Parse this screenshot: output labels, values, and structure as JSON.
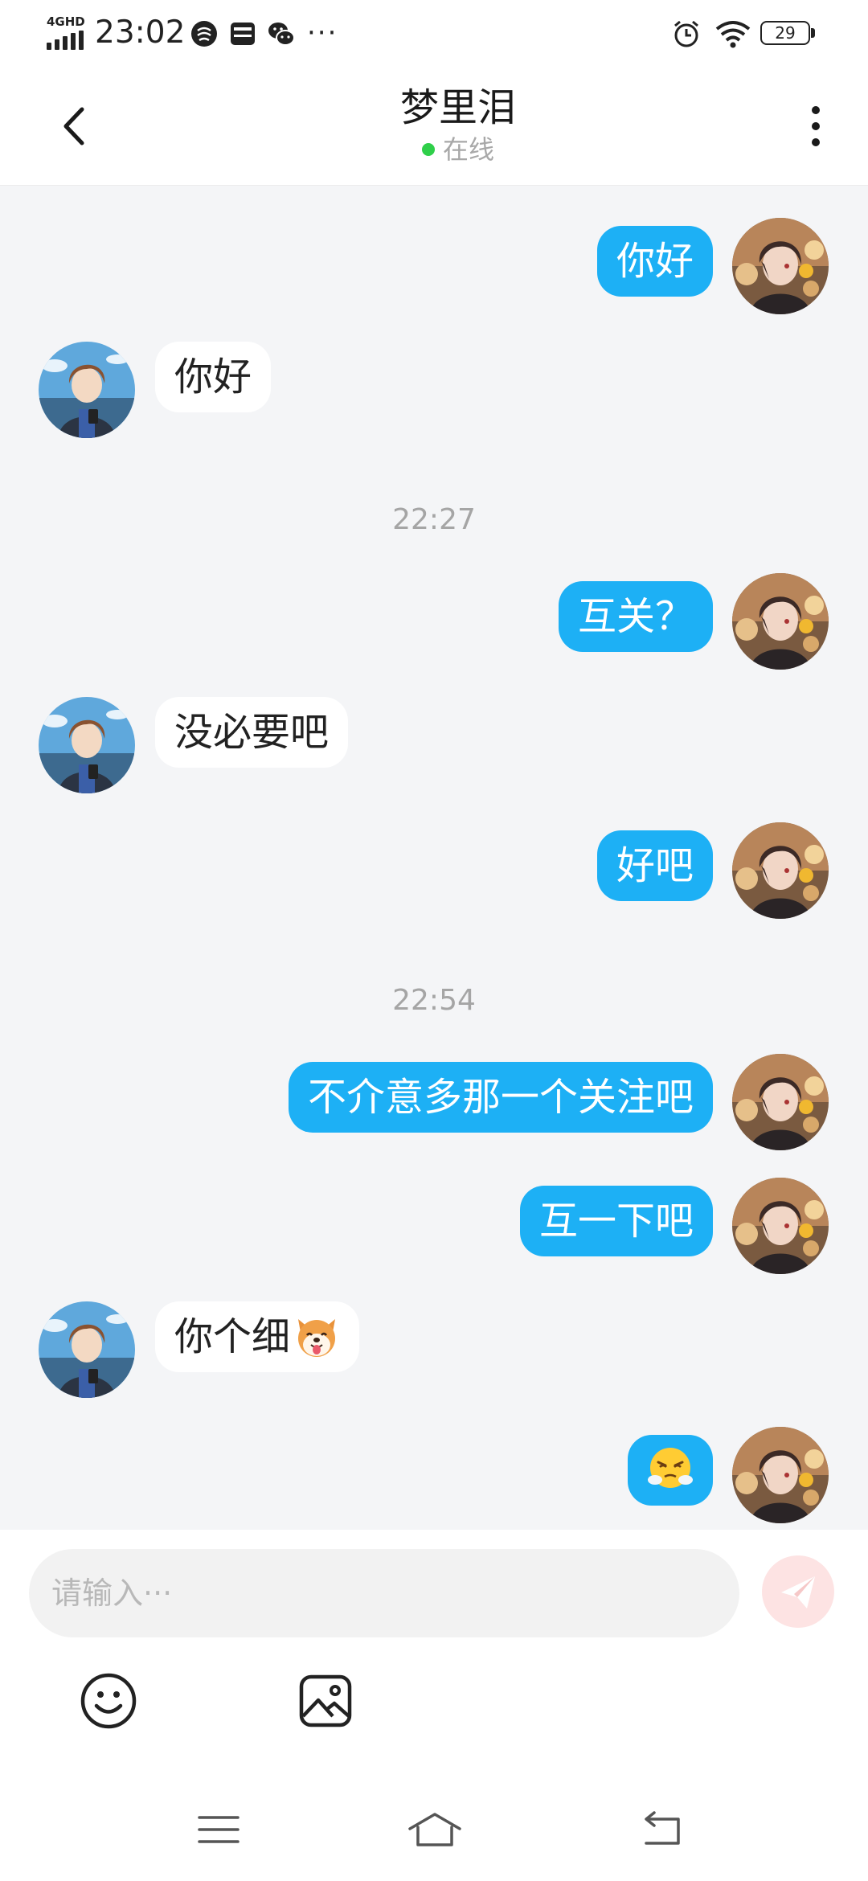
{
  "status_bar": {
    "network": "4GHD",
    "time": "23:02",
    "more": "···",
    "battery": "29",
    "icons": [
      "soul-app-icon",
      "card-icon",
      "wechat-icon",
      "alarm-icon",
      "wifi-icon",
      "battery-icon"
    ]
  },
  "header": {
    "title": "梦里泪",
    "status": "在线",
    "status_color": "#2fcf4a",
    "icons": [
      "back-arrow-icon",
      "more-vertical-icon"
    ]
  },
  "messages": [
    {
      "type": "message",
      "from": "me",
      "text": "你好"
    },
    {
      "type": "message",
      "from": "them",
      "text": "你好"
    },
    {
      "type": "time",
      "text": "22:27"
    },
    {
      "type": "message",
      "from": "me",
      "text": "互关？"
    },
    {
      "type": "message",
      "from": "them",
      "text": "没必要吧"
    },
    {
      "type": "message",
      "from": "me",
      "text": "好吧"
    },
    {
      "type": "time",
      "text": "22:54"
    },
    {
      "type": "message",
      "from": "me",
      "text": "不介意多那一个关注吧"
    },
    {
      "type": "message",
      "from": "me",
      "text": "互一下吧"
    },
    {
      "type": "message",
      "from": "them",
      "text": "你个细",
      "emoji": "shiba-dog-emoji"
    },
    {
      "type": "message",
      "from": "me",
      "text": "",
      "emoji": "huffing-face-emoji"
    }
  ],
  "composer": {
    "placeholder": "请输入···",
    "icons": [
      "send-icon",
      "smiley-icon",
      "image-icon"
    ]
  },
  "nav_bar": {
    "icons": [
      "menu-icon",
      "home-icon",
      "back-icon"
    ]
  },
  "colors": {
    "my_bubble": "#1db0f5",
    "their_bubble": "#ffffff",
    "chat_background": "#f4f5f7",
    "send_button": "#fde3e3"
  }
}
